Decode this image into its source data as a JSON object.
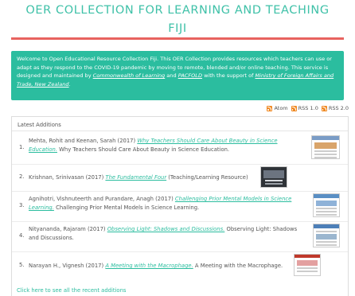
{
  "site": {
    "title_line1": "OER COLLECTION FOR LEARNING AND TEACHING",
    "title_line2": "FIJI"
  },
  "welcome": {
    "text_start": "Welcome to Open Educational Resource Collection Fiji. This OER Collection provides resources which teachers can use or adapt as they respond to the COVID-19 pandemic by moving to remote, blended and/or online teaching. This service is designed and maintained by ",
    "link_col": "Commonwealth of Learning",
    "text_and": " and ",
    "link_pacfold": "PACFOLD",
    "text_support": " with the support of ",
    "link_ministry": "Ministry of Foreign Affairs and Trade, New Zealand",
    "text_end": "."
  },
  "feeds": [
    {
      "label": "Atom",
      "icon": "rss-icon"
    },
    {
      "label": "RSS 1.0",
      "icon": "rss-icon"
    },
    {
      "label": "RSS 2.0",
      "icon": "rss-icon"
    }
  ],
  "latest": {
    "heading": "Latest Additions",
    "items": [
      {
        "num": "1.",
        "authors": "Mehta, Rohit and Keenan, Sarah (2017) ",
        "title": "Why Teachers Should Care About Beauty in Science Education.",
        "desc": " Why Teachers Should Care About Beauty in Science Education."
      },
      {
        "num": "2.",
        "authors": "Krishnan, Srinivasan (2017) ",
        "title": "The Fundamental Four",
        "desc": " (Teaching/Learning Resource)"
      },
      {
        "num": "3.",
        "authors": "Agnihotri, Vishnuteerth and Purandare, Anagh (2017) ",
        "title": "Challenging Prior Mental Models in Science Learning.",
        "desc": " Challenging Prior Mental Models in Science Learning."
      },
      {
        "num": "4.",
        "authors": "Nityananda, Rajaram (2017) ",
        "title": "Observing Light: Shadows and Discussions.",
        "desc": " Observing Light: Shadows and Discussions."
      },
      {
        "num": "5.",
        "authors": "Narayan H., Vignesh (2017) ",
        "title": "A Meeting with the Macrophage.",
        "desc": " A Meeting with the Macrophage."
      }
    ],
    "see_all": "Click here to see all the recent additions"
  },
  "colors": {
    "accent_teal": "#2bbd9f",
    "title_teal": "#3fc1a8",
    "rule_red": "#e8635f",
    "feed_orange": "#f08a24"
  }
}
